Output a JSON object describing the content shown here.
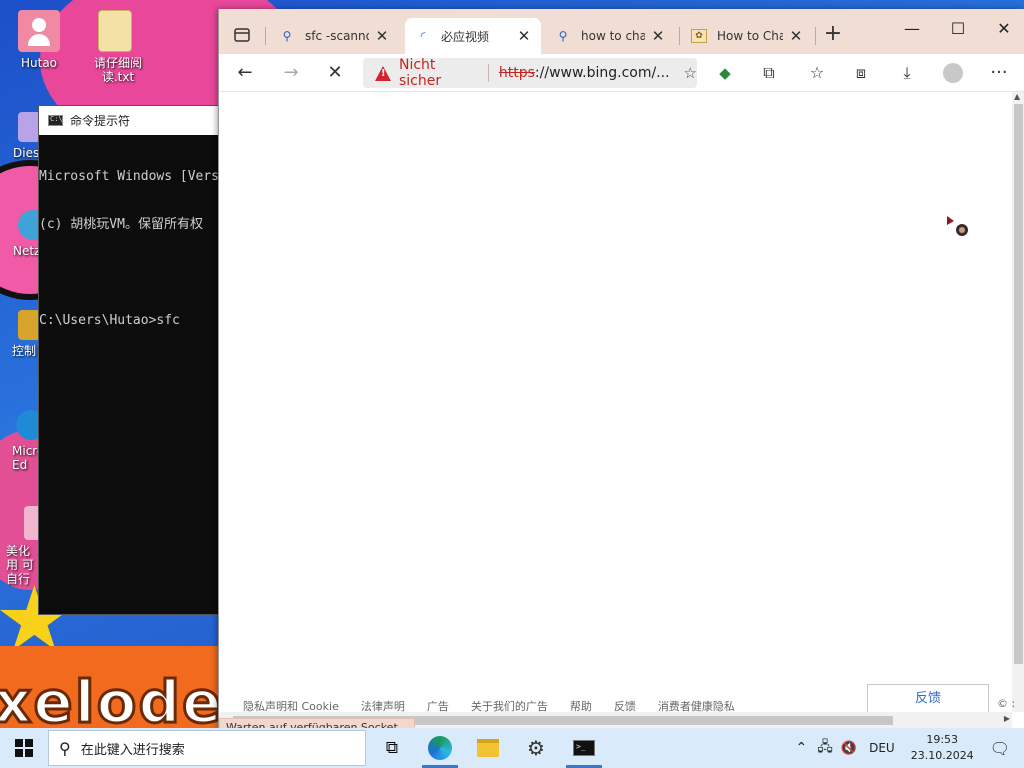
{
  "desktop": {
    "icons": [
      {
        "label": "Hutao"
      },
      {
        "label": "请仔细阅读.txt"
      },
      {
        "label": "Diese"
      },
      {
        "label": "Netz"
      },
      {
        "label": "控制"
      },
      {
        "label": "Micro Ed"
      },
      {
        "label": "美化用 可自行"
      }
    ],
    "wallpaper_text": "xelode"
  },
  "cmd": {
    "title": "命令提示符",
    "lines": [
      "Microsoft Windows [Vers",
      "(c) 胡桃玩VM。保留所有权",
      "",
      "C:\\Users\\Hutao>sfc"
    ]
  },
  "browser": {
    "tabs": [
      {
        "label": "sfc -scannow",
        "icon": "search-icon"
      },
      {
        "label": "必应视频",
        "icon": "loading-spinner-icon"
      },
      {
        "label": "how to chang",
        "icon": "search-icon"
      },
      {
        "label": "How to Chan",
        "icon": "site-favicon-icon"
      }
    ],
    "address": {
      "security_label": "Nicht sicher",
      "scheme": "https",
      "rest": "://www.bing.com/..."
    },
    "footer_links": [
      "隐私声明和 Cookie",
      "法律声明",
      "广告",
      "关于我们的广告",
      "帮助",
      "反馈",
      "消费者健康隐私"
    ],
    "feedback_button": "反馈",
    "footer_right": "© :",
    "status_text": "Warten auf verfügbaren Socket..."
  },
  "taskbar": {
    "search_placeholder": "在此键入进行搜索",
    "language": "DEU",
    "time": "19:53",
    "date": "23.10.2024"
  },
  "colors": {
    "tabbar_bg": "#f0ded4",
    "insecure_red": "#c3261e",
    "taskbar_bg": "#d9ebfa",
    "link_blue": "#2e69c9"
  }
}
